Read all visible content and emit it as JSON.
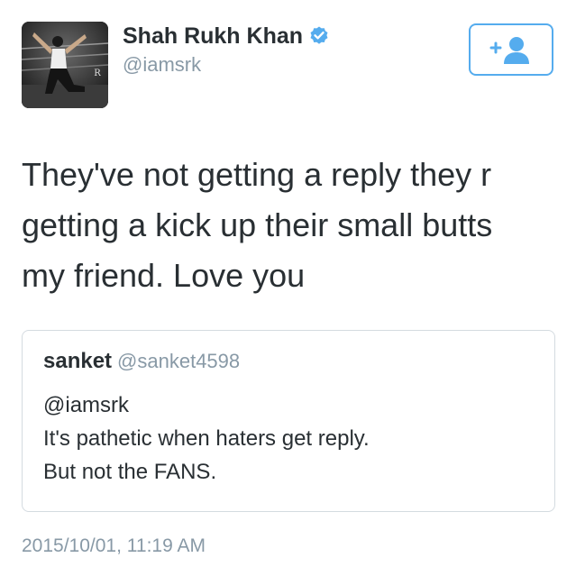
{
  "tweet": {
    "author": {
      "display_name": "Shah Rukh Khan",
      "handle": "@iamsrk",
      "verified": true,
      "avatar_icon": "profile-photo"
    },
    "follow_button": {
      "icon": "add-user-icon",
      "accent_color": "#55acee"
    },
    "text_lines": [
      "They've not getting a reply they r",
      "getting a kick up their small butts",
      "my friend. Love you"
    ],
    "quoted_tweet": {
      "display_name": "sanket",
      "handle": "@sanket4598",
      "body_lines": [
        "@iamsrk",
        "It's pathetic when haters get reply.",
        "But not the FANS."
      ]
    },
    "timestamp": "2015/10/01, 11:19 AM"
  },
  "colors": {
    "text": "#292f33",
    "secondary": "#8899a6",
    "accent": "#55acee",
    "border": "#d4dbe0"
  }
}
